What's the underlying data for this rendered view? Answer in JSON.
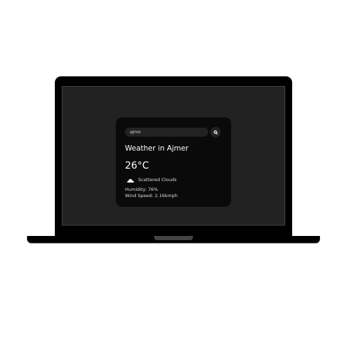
{
  "search": {
    "value": "ajmer",
    "icon": "search-icon"
  },
  "weather": {
    "title": "Weather in Ajmer",
    "temperature": "26°C",
    "condition_icon": "cloud-icon",
    "condition": "Scattered Clouds",
    "humidity": "Humidity: 76%",
    "wind": "Wind Speed: 2.16kmph"
  }
}
